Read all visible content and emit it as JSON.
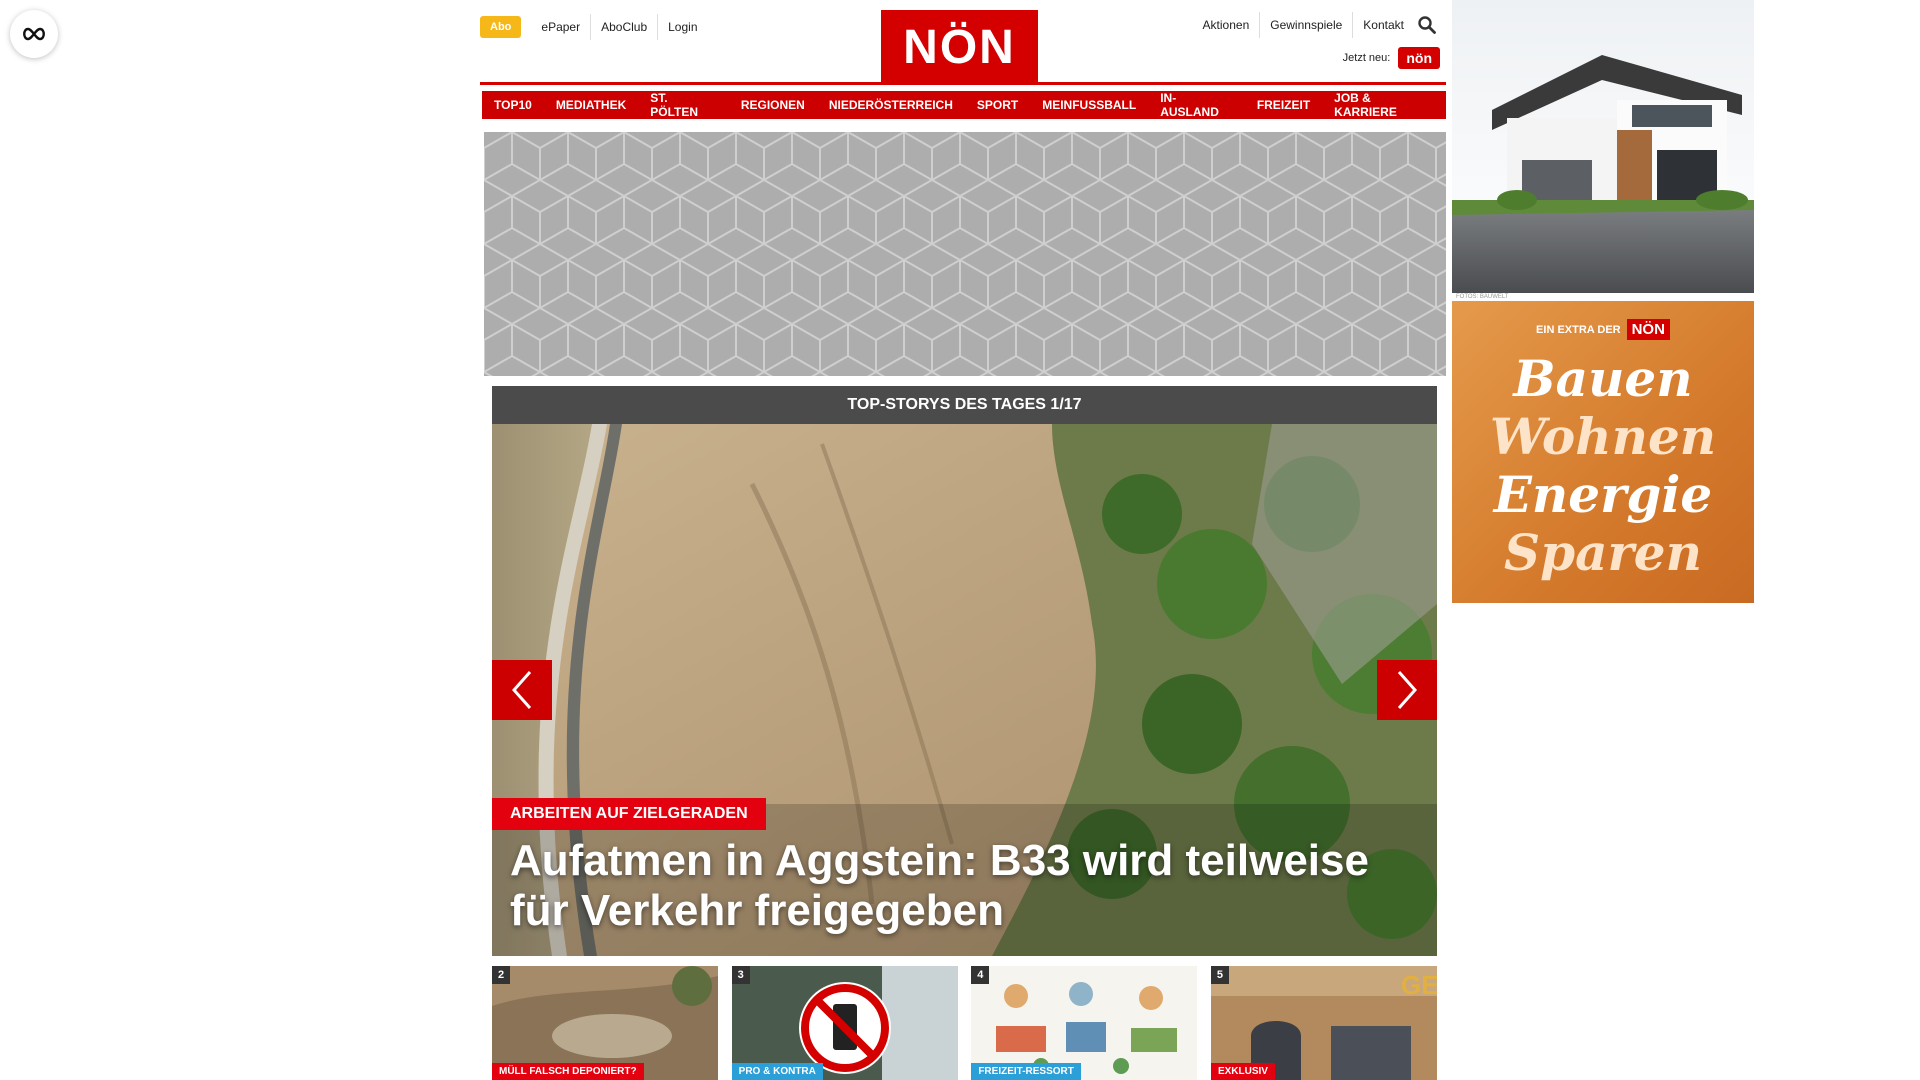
{
  "header": {
    "abo": "Abo",
    "left_links": [
      "ePaper",
      "AboClub",
      "Login"
    ],
    "logo": "NÖN",
    "right_links": [
      "Aktionen",
      "Gewinnspiele",
      "Kontakt"
    ],
    "jetzt_neu": "Jetzt neu:",
    "jetzt_badge": "nön"
  },
  "nav": [
    "TOP10",
    "MEDIATHEK",
    "ST. PÖLTEN",
    "REGIONEN",
    "NIEDERÖSTERREICH",
    "SPORT",
    "MEINFUSSBALL",
    "IN-AUSLAND",
    "FREIZEIT",
    "JOB & KARRIERE"
  ],
  "side_ad": {
    "caption": "FOTOS: BAUWELT",
    "extra_label": "EIN EXTRA DER",
    "extra_brand": "NÖN",
    "words": [
      "Bauen",
      "Wohnen",
      "Energie",
      "Sparen"
    ]
  },
  "carousel": {
    "title": "TOP-STORYS DES TAGES 1/17",
    "kicker": "ARBEITEN AUF ZIELGERADEN",
    "headline": "Aufatmen in Aggstein: B33 wird teilweise für Verkehr freigegeben"
  },
  "thumbs": [
    {
      "num": "2",
      "label": "MÜLL FALSCH DEPONIERT?",
      "color": "#e3000f"
    },
    {
      "num": "3",
      "label": "PRO & KONTRA",
      "color": "#2a9fd8"
    },
    {
      "num": "4",
      "label": "FREIZEIT-RESSORT",
      "color": "#2a9fd8"
    },
    {
      "num": "5",
      "label": "EXKLUSIV",
      "color": "#e3000f"
    }
  ],
  "colors": {
    "brand_red": "#d40000",
    "abo_yellow": "#f6b719",
    "head_gray": "#4b4b4b"
  }
}
